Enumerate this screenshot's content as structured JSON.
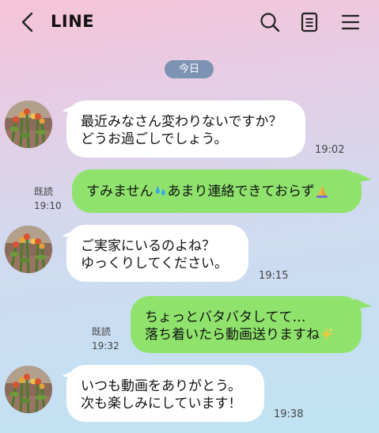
{
  "header": {
    "title": "LINE",
    "back_icon": "chevron-left-icon",
    "actions": [
      "search-icon",
      "notes-icon",
      "menu-icon"
    ]
  },
  "date_label": "今日",
  "colors": {
    "incoming_bubble": "#ffffff",
    "outgoing_bubble": "#8fe36c",
    "date_pill": "#7d93b3"
  },
  "messages": [
    {
      "direction": "incoming",
      "lines": [
        "最近みなさん変わりないですか？",
        "どうお過ごしでしょう。"
      ],
      "time": "19:02"
    },
    {
      "direction": "outgoing",
      "lines": [
        "すみません",
        "あまり連絡できておらず"
      ],
      "emojis": [
        "droplets-icon",
        "folded-hands-icon"
      ],
      "read": "既読",
      "time": "19:10"
    },
    {
      "direction": "incoming",
      "lines": [
        "ご実家にいるのよね？",
        "ゆっくりしてください。"
      ],
      "time": "19:15"
    },
    {
      "direction": "outgoing",
      "lines": [
        "ちょっとバタバタしてて…",
        "落ち着いたら動画送りますね"
      ],
      "emojis": [
        "sparkles-icon"
      ],
      "read": "既読",
      "time": "19:32"
    },
    {
      "direction": "incoming",
      "lines": [
        "いつも動画をありがとう。",
        "次も楽しみにしています！"
      ],
      "time": "19:38"
    }
  ]
}
